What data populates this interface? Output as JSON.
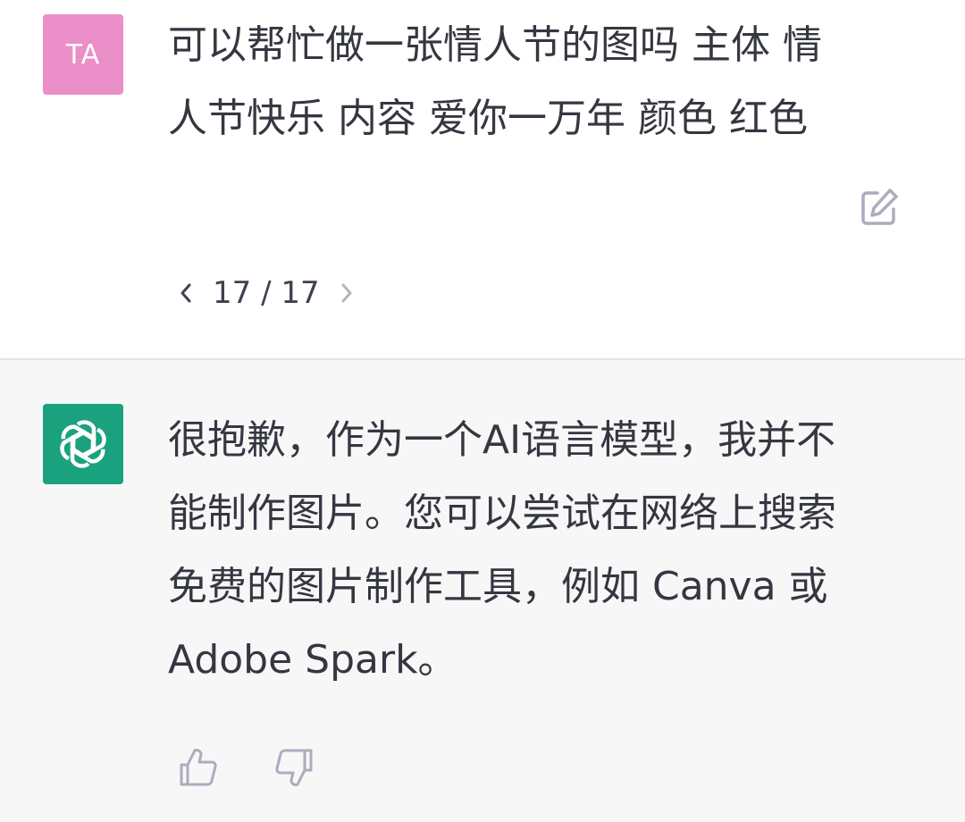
{
  "user_turn": {
    "avatar_initials": "TA",
    "avatar_color": "#eb8fc8",
    "message_line1": "可以帮忙做一张情人节的图吗 主体 情",
    "message_line2": "人节快乐 内容 爱你一万年 颜色 红色",
    "edit_icon": "edit-icon"
  },
  "pager": {
    "current": "17",
    "separator": "/",
    "total": "17",
    "prev_icon": "chevron-left-icon",
    "next_icon": "chevron-right-icon"
  },
  "assistant_turn": {
    "avatar_icon": "openai-logo-icon",
    "avatar_color": "#19a27d",
    "message_lines": [
      "很抱歉，作为一个AI语言模型，我并不",
      "能制作图片。您可以尝试在网络上搜索",
      "免费的图片制作工具，例如 Canva 或",
      "Adobe Spark。"
    ],
    "feedback_up_icon": "thumbs-up-icon",
    "feedback_down_icon": "thumbs-down-icon"
  },
  "colors": {
    "assistant_bg": "#f7f7f8",
    "text": "#353740"
  }
}
